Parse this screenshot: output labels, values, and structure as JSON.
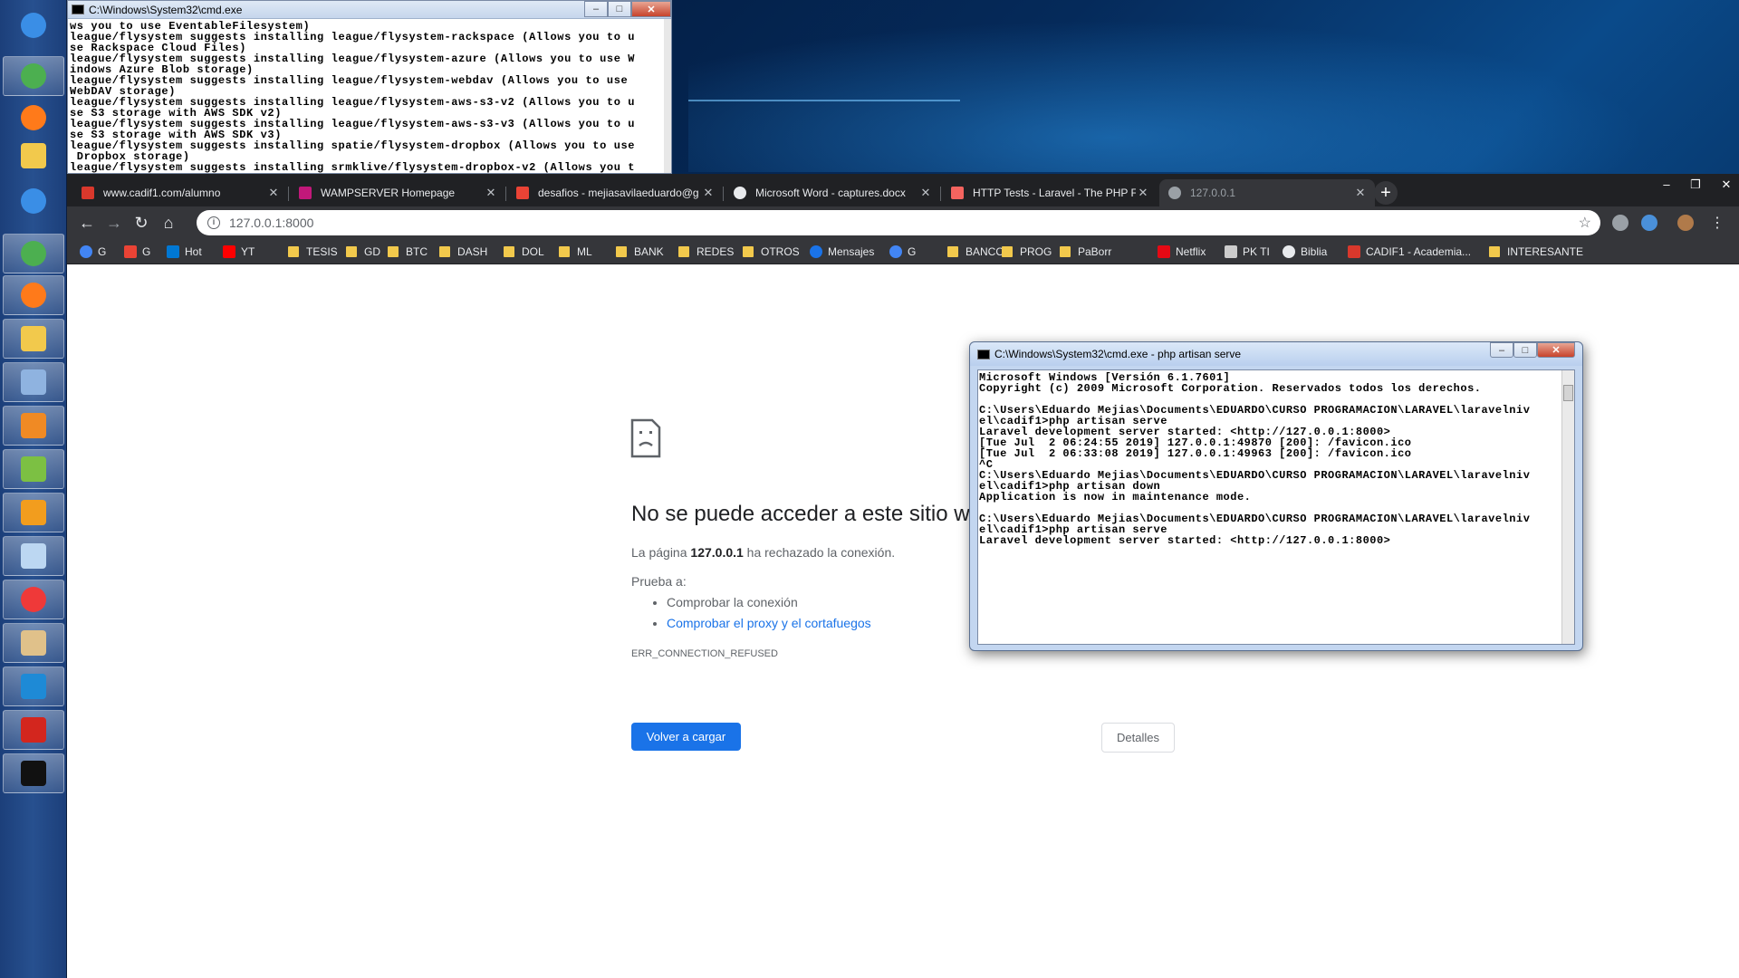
{
  "cmd_top": {
    "title": "C:\\Windows\\System32\\cmd.exe",
    "lines": [
      "ws you to use EventableFilesystem)",
      "league/flysystem suggests installing league/flysystem-rackspace (Allows you to u",
      "se Rackspace Cloud Files)",
      "league/flysystem suggests installing league/flysystem-azure (Allows you to use W",
      "indows Azure Blob storage)",
      "league/flysystem suggests installing league/flysystem-webdav (Allows you to use",
      "WebDAV storage)",
      "league/flysystem suggests installing league/flysystem-aws-s3-v2 (Allows you to u",
      "se S3 storage with AWS SDK v2)",
      "league/flysystem suggests installing league/flysystem-aws-s3-v3 (Allows you to u",
      "se S3 storage with AWS SDK v3)",
      "league/flysystem suggests installing spatie/flysystem-dropbox (Allows you to use",
      " Dropbox storage)",
      "league/flysystem suggests installing srmklive/flysystem-dropbox-v2 (Allows you t"
    ]
  },
  "browser": {
    "tabs": [
      {
        "label": "www.cadif1.com/alumno",
        "icon": "cadif1-icon",
        "color": "#d9382c"
      },
      {
        "label": "WAMPSERVER Homepage",
        "icon": "wampserver-icon",
        "color": "#c2187a"
      },
      {
        "label": "desafios - mejiasavilaeduardo@g",
        "icon": "gmail-icon",
        "color": "#ea4335"
      },
      {
        "label": "Microsoft Word - captures.docx",
        "icon": "globe-icon",
        "color": "#e8eaed"
      },
      {
        "label": "HTTP Tests - Laravel - The PHP Fr",
        "icon": "laravel-icon",
        "color": "#f4645f"
      },
      {
        "label": "127.0.0.1",
        "icon": "globe-icon",
        "color": "#9aa0a6"
      }
    ],
    "url": "127.0.0.1:8000",
    "bookmarks": [
      {
        "label": "G",
        "type": "google"
      },
      {
        "label": "G",
        "type": "gmail"
      },
      {
        "label": "Hot",
        "type": "hotmail"
      },
      {
        "label": "YT",
        "type": "youtube"
      },
      {
        "label": "TESIS",
        "type": "folder"
      },
      {
        "label": "GD",
        "type": "folder"
      },
      {
        "label": "BTC",
        "type": "folder"
      },
      {
        "label": "DASH",
        "type": "folder"
      },
      {
        "label": "DOL",
        "type": "folder"
      },
      {
        "label": "ML",
        "type": "folder"
      },
      {
        "label": "BANK",
        "type": "folder"
      },
      {
        "label": "REDES",
        "type": "folder"
      },
      {
        "label": "OTROS",
        "type": "folder"
      },
      {
        "label": "Mensajes",
        "type": "messages"
      },
      {
        "label": "G",
        "type": "google"
      },
      {
        "label": "BANCOS",
        "type": "folder"
      },
      {
        "label": "PROG",
        "type": "folder"
      },
      {
        "label": "PaBorr",
        "type": "folder"
      },
      {
        "label": "Netflix",
        "type": "netflix"
      },
      {
        "label": "PK TI",
        "type": "pkti"
      },
      {
        "label": "Biblia",
        "type": "globe"
      },
      {
        "label": "CADIF1 - Academia...",
        "type": "cadif1"
      },
      {
        "label": "INTERESANTE",
        "type": "folder"
      }
    ]
  },
  "error_page": {
    "title": "No se puede acceder a este sitio w",
    "desc_prefix": "La página ",
    "desc_host": "127.0.0.1",
    "desc_suffix": " ha rechazado la conexión.",
    "try_label": "Prueba a:",
    "suggestion_1": "Comprobar la conexión",
    "suggestion_2": "Comprobar el proxy y el cortafuegos",
    "error_code": "ERR_CONNECTION_REFUSED",
    "reload_label": "Volver a cargar",
    "details_label": "Detalles"
  },
  "cmd_serve": {
    "title": "C:\\Windows\\System32\\cmd.exe - php  artisan serve",
    "lines": [
      "Microsoft Windows [Versión 6.1.7601]",
      "Copyright (c) 2009 Microsoft Corporation. Reservados todos los derechos.",
      "",
      "C:\\Users\\Eduardo Mejias\\Documents\\EDUARDO\\CURSO PROGRAMACION\\LARAVEL\\laravelniv",
      "el\\cadif1>php artisan serve",
      "Laravel development server started: <http://127.0.0.1:8000>",
      "[Tue Jul  2 06:24:55 2019] 127.0.0.1:49870 [200]: /favicon.ico",
      "[Tue Jul  2 06:33:08 2019] 127.0.0.1:49963 [200]: /favicon.ico",
      "^C",
      "C:\\Users\\Eduardo Mejias\\Documents\\EDUARDO\\CURSO PROGRAMACION\\LARAVEL\\laravelniv",
      "el\\cadif1>php artisan down",
      "Application is now in maintenance mode.",
      "",
      "C:\\Users\\Eduardo Mejias\\Documents\\EDUARDO\\CURSO PROGRAMACION\\LARAVEL\\laravelniv",
      "el\\cadif1>php artisan serve",
      "Laravel development server started: <http://127.0.0.1:8000>"
    ]
  },
  "taskbar": {
    "items": [
      {
        "name": "start-orb-icon",
        "color": "#3a8ee6"
      },
      {
        "name": "chrome-icon",
        "color": "#4caf50"
      },
      {
        "name": "firefox-icon",
        "color": "#ff7a1a"
      },
      {
        "name": "file-explorer-icon",
        "color": "#f2c94c"
      },
      {
        "name": "windows-orb-icon",
        "color": "#3a8ee6"
      },
      {
        "name": "chrome-icon",
        "color": "#4caf50"
      },
      {
        "name": "firefox-icon",
        "color": "#ff7a1a"
      },
      {
        "name": "file-explorer-icon",
        "color": "#f2c94c"
      },
      {
        "name": "calculator-icon",
        "color": "#8fb3e0"
      },
      {
        "name": "media-player-icon",
        "color": "#f08a24"
      },
      {
        "name": "layers-icon",
        "color": "#7cc043"
      },
      {
        "name": "sublime-text-icon",
        "color": "#f29d1e"
      },
      {
        "name": "notepad-icon",
        "color": "#bcd7f2"
      },
      {
        "name": "vivaldi-icon",
        "color": "#ef3939"
      },
      {
        "name": "paint-icon",
        "color": "#e0c18a"
      },
      {
        "name": "vscode-icon",
        "color": "#1e8ad6"
      },
      {
        "name": "acrobat-icon",
        "color": "#d3261e"
      },
      {
        "name": "cmd-icon",
        "color": "#111111"
      }
    ]
  }
}
